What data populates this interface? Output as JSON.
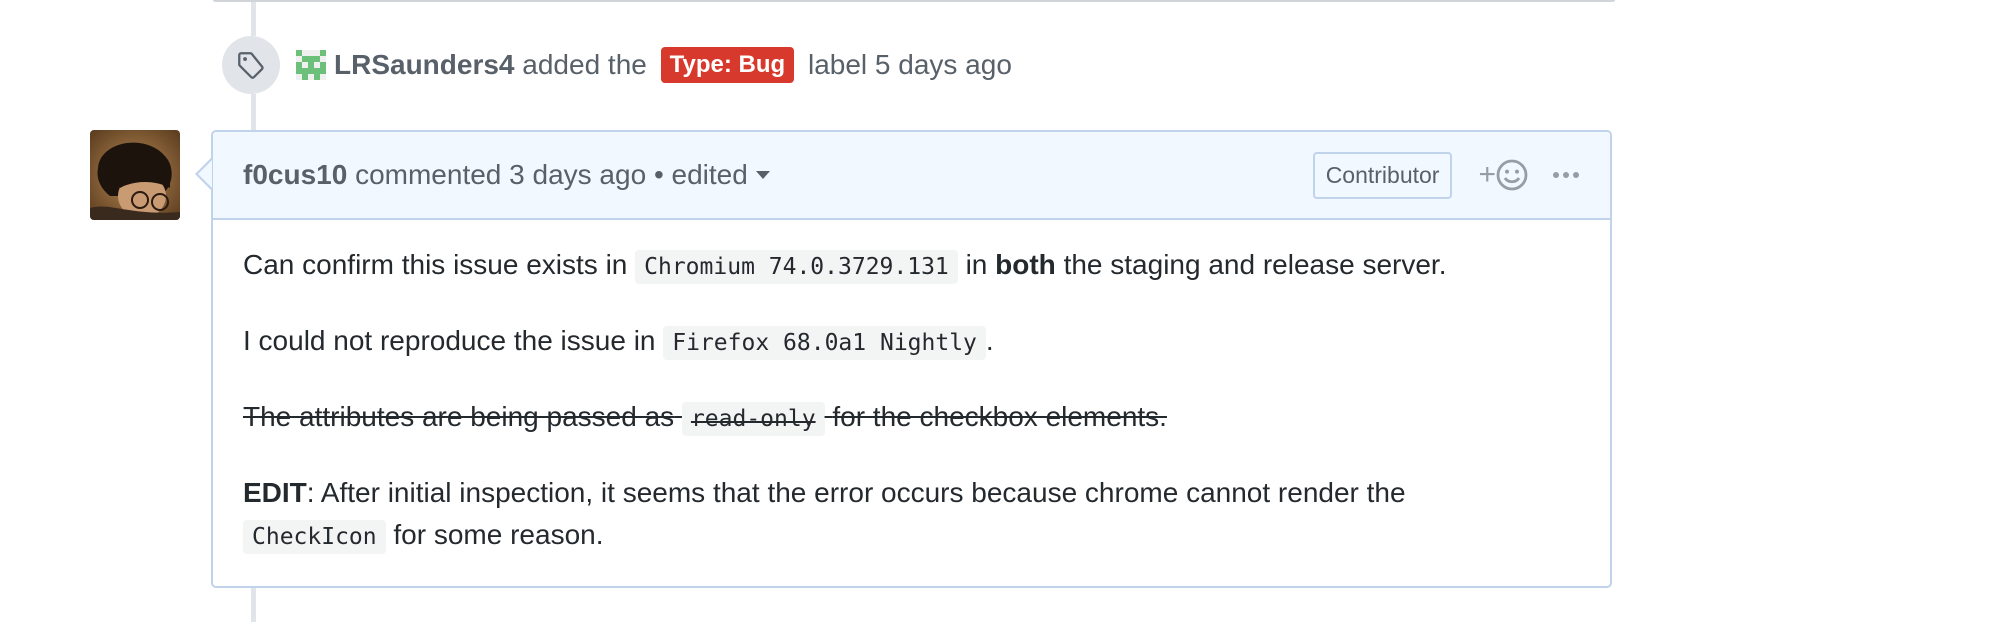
{
  "label_event": {
    "author": "LRSaunders4",
    "action_text": "added the",
    "label": "Type: Bug",
    "suffix_text": "label 5 days ago",
    "label_color": "#d73a2c",
    "icon": "tag-icon"
  },
  "comment": {
    "author": "f0cus10",
    "action_text": "commented",
    "time": "3 days ago",
    "separator": "•",
    "edited_label": "edited",
    "role_badge": "Contributor",
    "reaction_plus": "+",
    "paragraphs": {
      "p1": {
        "before": "Can confirm this issue exists in",
        "code": "Chromium 74.0.3729.131",
        "middle": "in",
        "bold": "both",
        "after": "the staging and release server."
      },
      "p2": {
        "before": "I could not reproduce the issue in",
        "code": "Firefox 68.0a1 Nightly",
        "after": "."
      },
      "p3": {
        "before": "The attributes are being passed as",
        "code": "read-only",
        "after": "for the checkbox elements."
      },
      "p4": {
        "bold": "EDIT",
        "before": ": After initial inspection, it seems that the error occurs because chrome cannot render the",
        "code": "CheckIcon",
        "after": "for some reason."
      }
    }
  },
  "colors": {
    "header_bg": "#f1f8ff",
    "border": "#c0d3eb",
    "muted_text": "#586069",
    "timeline": "#e1e4e8"
  }
}
